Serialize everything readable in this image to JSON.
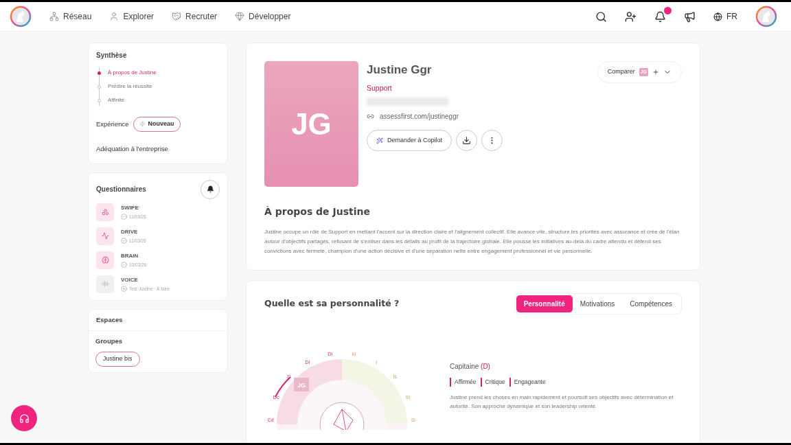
{
  "nav": {
    "items": [
      {
        "label": "Réseau"
      },
      {
        "label": "Explorer"
      },
      {
        "label": "Recruter"
      },
      {
        "label": "Développer"
      }
    ],
    "language": "FR",
    "notification_badge": true
  },
  "sidebar": {
    "synthese": {
      "title": "Synthèse",
      "items": [
        {
          "label": "À propos de Justine",
          "selected": true
        },
        {
          "label": "Prédire la réussite",
          "selected": false
        },
        {
          "label": "Affinité",
          "selected": false
        }
      ],
      "experience": "Expérience",
      "experience_badge": "Nouveau",
      "adequation": "Adéquation à l'entreprise"
    },
    "questionnaires": {
      "title": "Questionnaires",
      "items": [
        {
          "name": "SWIPE",
          "meta": "11/03/26",
          "done": true
        },
        {
          "name": "DRIVE",
          "meta": "11/03/26",
          "done": true
        },
        {
          "name": "BRAIN",
          "meta": "10/03/26",
          "done": true
        },
        {
          "name": "VOICE",
          "meta": "Test Justine · À faire",
          "done": false
        }
      ]
    },
    "espaces": "Espaces",
    "groupes": {
      "title": "Groupes",
      "tags": [
        "Justine bis"
      ]
    }
  },
  "profile": {
    "initials": "JG",
    "name": "Justine Ggr",
    "role": "Support",
    "link": "assessfirst.com/justineggr",
    "copilot": "Demander à Copilot",
    "compare": "Comparer",
    "compare_initials": "JG"
  },
  "about": {
    "title": "À propos de Justine",
    "text": "Justine occupe un rôle de Support en mettant l'accent sur la direction claire et l'alignement collectif. Elle avance vite, structure les priorités avec assurance et crée de l'élan autour d'objectifs partagés, refusant de s'enliser dans les détails au profit de la trajectoire globale. Elle pousse les initiatives au-delà du cadre attendu et défend ses convictions avec fermeté, champion d'une action décisive et d'une séparation nette entre engagement professionnel et vie personnelle."
  },
  "personality": {
    "title": "Quelle est sa personnalité ?",
    "tabs": [
      {
        "label": "Personnalité",
        "selected": true
      },
      {
        "label": "Motivations",
        "selected": false
      },
      {
        "label": "Compétences",
        "selected": false
      }
    ],
    "wheel_labels": [
      "Cd",
      "Dc",
      "D",
      "Di",
      "Di",
      "Id",
      "I",
      "Is",
      "Si",
      "Si"
    ],
    "wheel_initials": "JG",
    "profile_name": "Capitaine",
    "profile_code": "(D)",
    "traits": [
      "Affirmée",
      "Critique",
      "Engageante"
    ],
    "description": "Justine prend les choses en main rapidement et poursuit ses objectifs avec détermination et autorité. Son approche dynamique et son leadership orienté"
  }
}
